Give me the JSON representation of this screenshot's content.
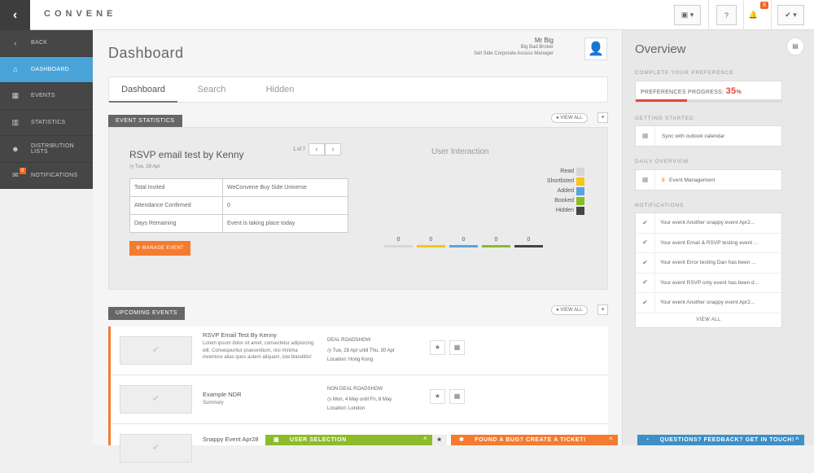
{
  "app": {
    "logo": "CONVENE",
    "back_glyph": "‹"
  },
  "topbar": {
    "help_label": "?",
    "notif_count": "8"
  },
  "sidebar": {
    "items": [
      {
        "label": "BACK",
        "icon": "‹"
      },
      {
        "label": "DASHBOARD",
        "icon": "⌂"
      },
      {
        "label": "EVENTS",
        "icon": "▦"
      },
      {
        "label": "STATISTICS",
        "icon": "▥"
      },
      {
        "label": "DISTRIBUTION LISTS",
        "icon": "☻"
      },
      {
        "label": "NOTIFICATIONS",
        "icon": "✉",
        "badge": "8"
      }
    ]
  },
  "main": {
    "title": "Dashboard",
    "user": {
      "name": "Mr Big",
      "role": "Big Bad Broker",
      "team": "Sell Side Corporate Access Manager"
    },
    "tabs": [
      "Dashboard",
      "Search",
      "Hidden"
    ],
    "stats": {
      "section_label": "EVENT STATISTICS",
      "view_all": "VIEW ALL",
      "event_title": "RSVP email test by Kenny",
      "event_date": "Tue, 28 Apr",
      "pager": "1 of 7",
      "table": [
        [
          "Total Invited",
          "WeConvene Buy Side Universe"
        ],
        [
          "Attendance Confirmed",
          "0"
        ],
        [
          "Days Remaining",
          "Event is taking place today"
        ]
      ],
      "manage_label": "MANAGE EVENT",
      "interaction_title": "User Interaction",
      "legend": [
        {
          "label": "Read",
          "color": "#d6d6d6"
        },
        {
          "label": "Shortlisted",
          "color": "#f5c518"
        },
        {
          "label": "Added",
          "color": "#5ba4db"
        },
        {
          "label": "Booked",
          "color": "#8dbb2a"
        },
        {
          "label": "Hidden",
          "color": "#444444"
        }
      ],
      "counts": [
        "0",
        "0",
        "0",
        "0",
        "0"
      ]
    },
    "upcoming": {
      "section_label": "UPCOMING EVENTS",
      "view_all": "VIEW ALL",
      "rows": [
        {
          "title": "RSVP Email Test By Kenny",
          "desc": "Lorem ipsum dolor sit amet, consectetur adipisicing elit. Consequuntur praesentium, nisi minima inventore alias quos autem aliquam, iste blanditiis!",
          "type": "DEAL ROADSHOW",
          "when": "Tue, 28 Apr until Thu, 30 Apr",
          "where": "Location: Hong Kong"
        },
        {
          "title": "Example NDR",
          "desc": "Summary",
          "type": "NON DEAL ROADSHOW",
          "when": "Mon, 4 May until Fri, 8 May",
          "where": "Location: London"
        },
        {
          "title": "Snappy Event Apr28",
          "desc": "",
          "type": "",
          "when": "",
          "where": ""
        }
      ]
    }
  },
  "overview": {
    "title": "Overview",
    "complete_label": "COMPLETE YOUR PREFERENCE",
    "progress_label": "PREFERENCES PROGRESS:",
    "progress_value": "35",
    "progress_unit": "%",
    "getting_started_label": "GETTING STARTED",
    "sync_label": "Sync with outlook calendar",
    "daily_label": "DAILY OVERVIEW",
    "daily_count": "8",
    "daily_item": "Event Management",
    "notifications_label": "NOTIFICATIONS",
    "notifications": [
      "Your event Another snappy event Apr2...",
      "Your event Email & RSVP testing event ...",
      "Your event Error testing Dan has been ...",
      "Your event RSVP only event has been d...",
      "Your event Another snappy event Apr2..."
    ],
    "notif_view_all": "VIEW ALL"
  },
  "floating": {
    "user_selection": "USER SELECTION",
    "bug": "FOUND A BUG? CREATE A TICKET!",
    "feedback": "QUESTIONS? FEEDBACK? GET IN TOUCH!"
  },
  "colors": {
    "accent_blue": "#4aa3d8",
    "accent_orange": "#f47b30",
    "progress_red": "#e04a3a",
    "sidebar_bg": "#464646"
  }
}
